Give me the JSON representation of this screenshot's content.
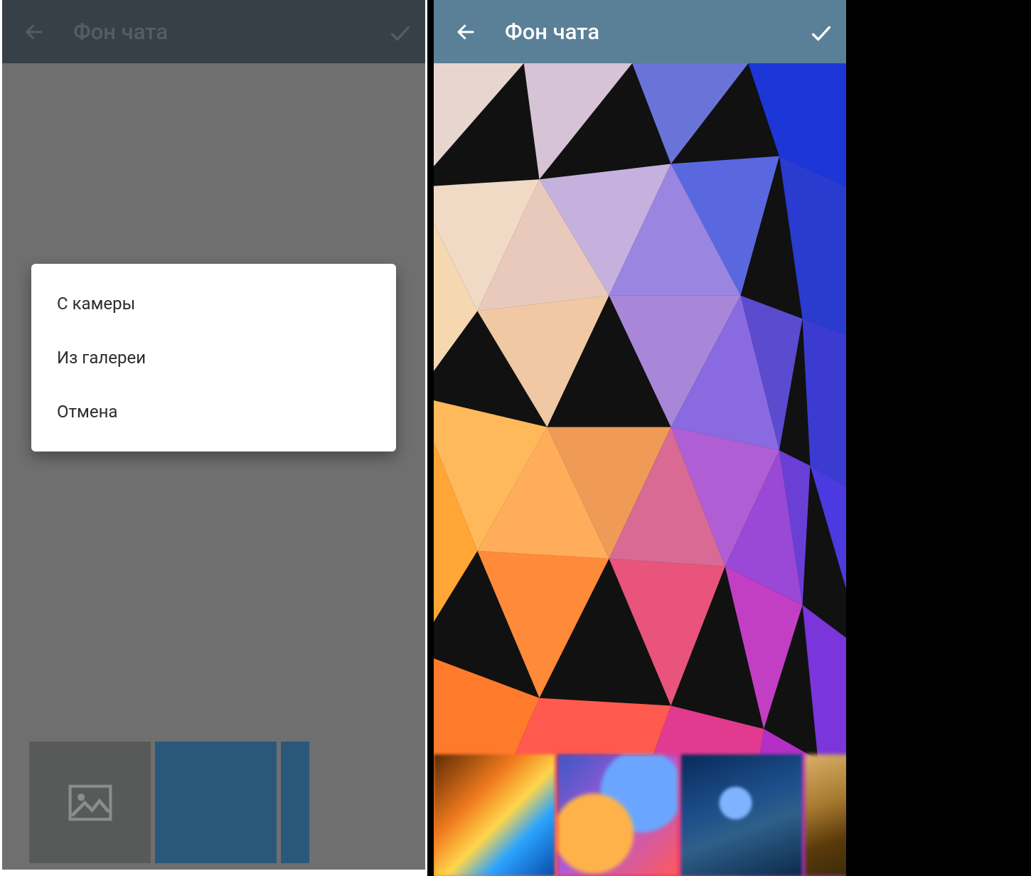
{
  "left": {
    "appbar": {
      "title": "Фон чата"
    },
    "dialog": {
      "options": [
        {
          "label": "С камеры"
        },
        {
          "label": "Из галереи"
        },
        {
          "label": "Отмена"
        }
      ]
    },
    "thumbs": {
      "selected_index": 0,
      "items": [
        "custom-image",
        "solid-blue",
        "striped-blue"
      ]
    }
  },
  "right": {
    "appbar": {
      "title": "Фон чата"
    },
    "thumbs": {
      "selected_index": 1,
      "items": [
        "nebula-orange",
        "lowpoly-color",
        "starry-blue",
        "bokeh-gold"
      ]
    }
  },
  "icons": {
    "back": "arrow-left",
    "confirm": "check",
    "picture": "image-placeholder"
  },
  "colors": {
    "selection_outline": "#ff0000",
    "left_appbar": "#30475b",
    "right_appbar": "#598096"
  }
}
